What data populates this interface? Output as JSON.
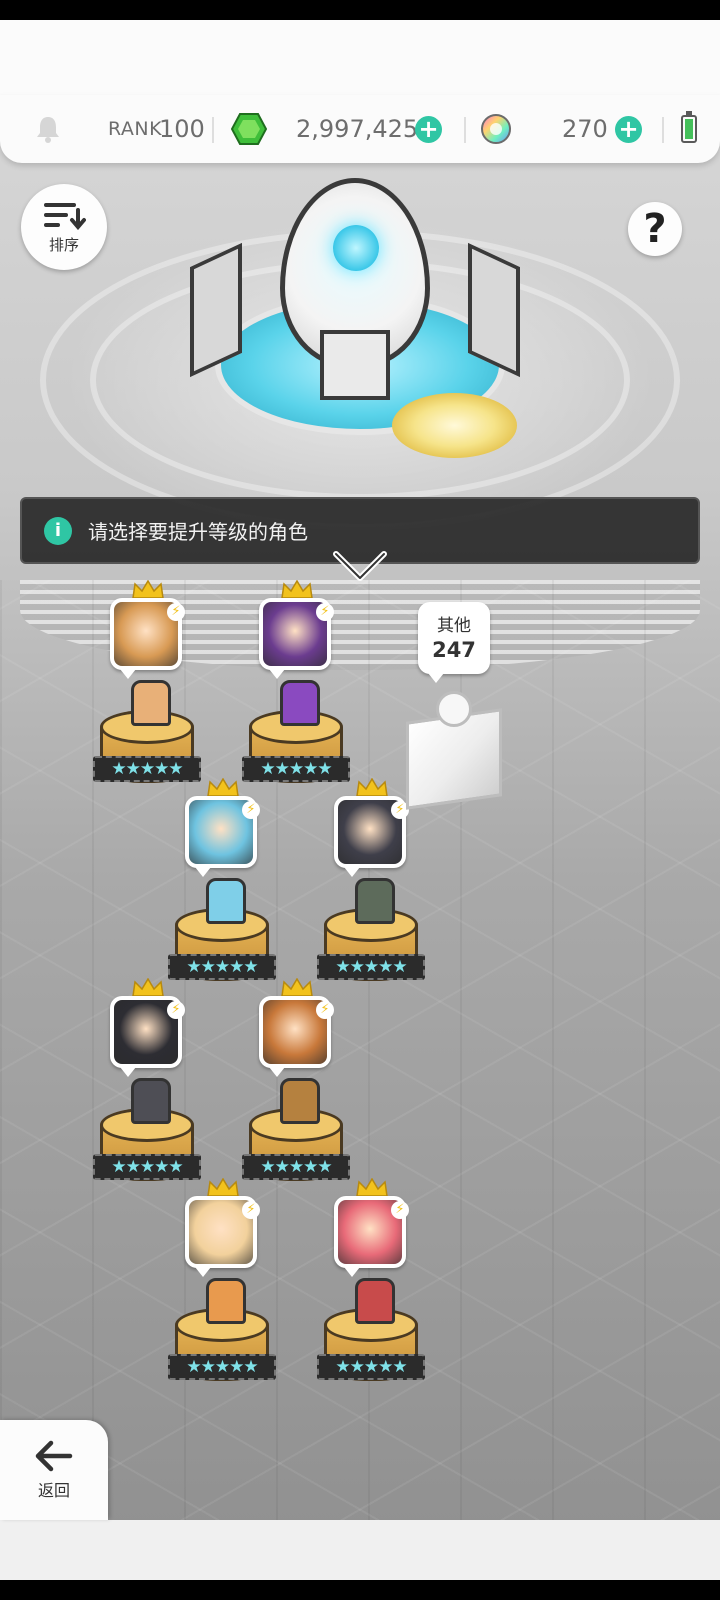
{
  "header": {
    "rank_label": "RANK",
    "rank_value": "100",
    "gems": "2,997,425",
    "orbs": "270"
  },
  "buttons": {
    "sort_label": "排序",
    "help_label": "?",
    "back_label": "返回"
  },
  "hint": {
    "text": "请选择要提升等级的角色"
  },
  "other": {
    "label": "其他",
    "count": "247"
  },
  "heroes": [
    {
      "name": "hero-1",
      "stars": "★★★★★",
      "portrait_color": "#d89a54",
      "sprite_color": "#e8b078"
    },
    {
      "name": "hero-2",
      "stars": "★★★★★",
      "portrait_color": "#6b3c8f",
      "sprite_color": "#8a4ac0"
    },
    {
      "name": "hero-3",
      "stars": "★★★★★",
      "portrait_color": "#6ec3e0",
      "sprite_color": "#7fcfe8"
    },
    {
      "name": "hero-4",
      "stars": "★★★★★",
      "portrait_color": "#3f3f4a",
      "sprite_color": "#5d6b5b"
    },
    {
      "name": "hero-5",
      "stars": "★★★★★",
      "portrait_color": "#2d2d33",
      "sprite_color": "#4e4e55"
    },
    {
      "name": "hero-6",
      "stars": "★★★★★",
      "portrait_color": "#c8783a",
      "sprite_color": "#b5813f"
    },
    {
      "name": "hero-7",
      "stars": "★★★★★",
      "portrait_color": "#f2d19c",
      "sprite_color": "#e89a4e"
    },
    {
      "name": "hero-8",
      "stars": "★★★★★",
      "portrait_color": "#e86a78",
      "sprite_color": "#c84b4b"
    }
  ],
  "colors": {
    "accent": "#2fc6a4",
    "crown": "#f2c21c",
    "hint_bg": "#2a2a2a"
  },
  "icons": {
    "bell": "bell-icon",
    "gem": "gem-icon",
    "orb": "orb-icon",
    "sort": "sort-icon",
    "info": "info-icon",
    "back": "back-arrow-icon"
  }
}
